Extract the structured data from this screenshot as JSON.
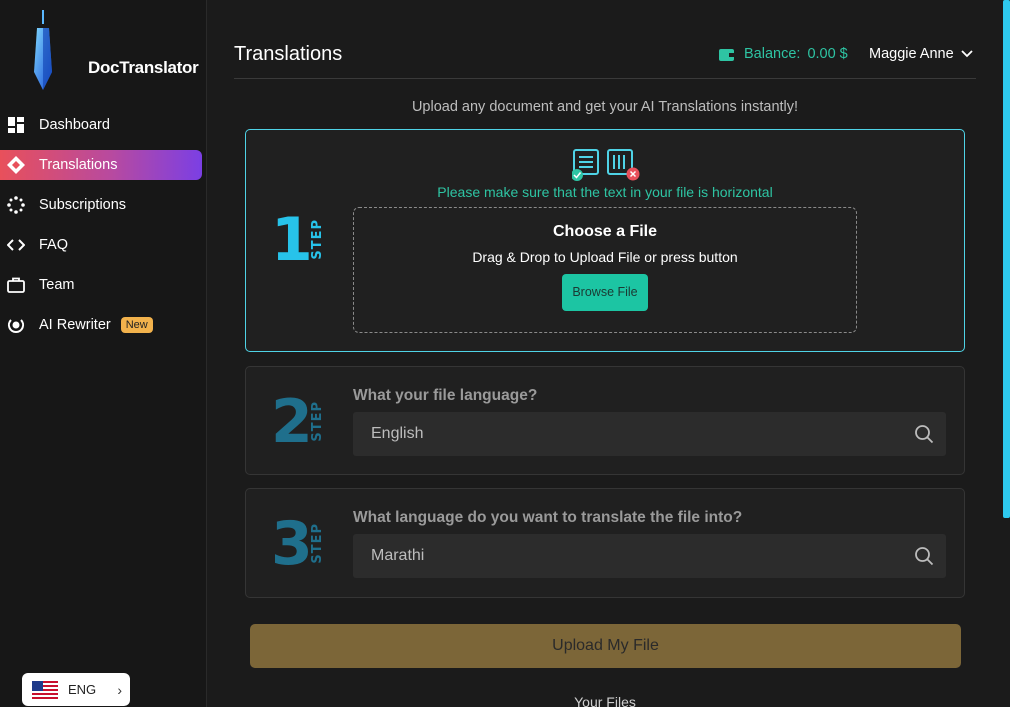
{
  "app": {
    "name": "DocTranslator"
  },
  "sidebar": {
    "items": [
      {
        "label": "Dashboard",
        "icon": "dashboard-icon",
        "active": false
      },
      {
        "label": "Translations",
        "icon": "translate-icon",
        "active": true
      },
      {
        "label": "Subscriptions",
        "icon": "sparkle-icon",
        "active": false
      },
      {
        "label": "FAQ",
        "icon": "code-brackets-icon",
        "active": false
      },
      {
        "label": "Team",
        "icon": "briefcase-icon",
        "active": false
      },
      {
        "label": "AI Rewriter",
        "icon": "rewriter-icon",
        "active": false,
        "badge": "New"
      }
    ],
    "language": {
      "label": "ENG",
      "flag": "us-flag-icon"
    }
  },
  "header": {
    "title": "Translations",
    "balance_label": "Balance:",
    "balance_value": "0.00 $",
    "user_name": "Maggie Anne"
  },
  "intro": "Upload any document and get your AI Translations instantly!",
  "steps": [
    {
      "number": "1",
      "step_word": "STEP",
      "note": "Please make sure that the text in your file is horizontal",
      "dropzone_title": "Choose a File",
      "dropzone_sub": "Drag & Drop to Upload File or press button",
      "browse_label": "Browse File"
    },
    {
      "number": "2",
      "step_word": "STEP",
      "question": "What your file language?",
      "value": "English"
    },
    {
      "number": "3",
      "step_word": "STEP",
      "question": "What language do you want to translate the file into?",
      "value": "Marathi"
    }
  ],
  "upload_label": "Upload My File",
  "your_files_label": "Your Files",
  "colors": {
    "accent_teal": "#2ec4a3",
    "step_active": "#27c3ea",
    "step_inactive": "#1f6f8c",
    "upload_button": "#7c6638",
    "nav_active_gradient": [
      "#e8505b",
      "#7b3fe4"
    ]
  }
}
